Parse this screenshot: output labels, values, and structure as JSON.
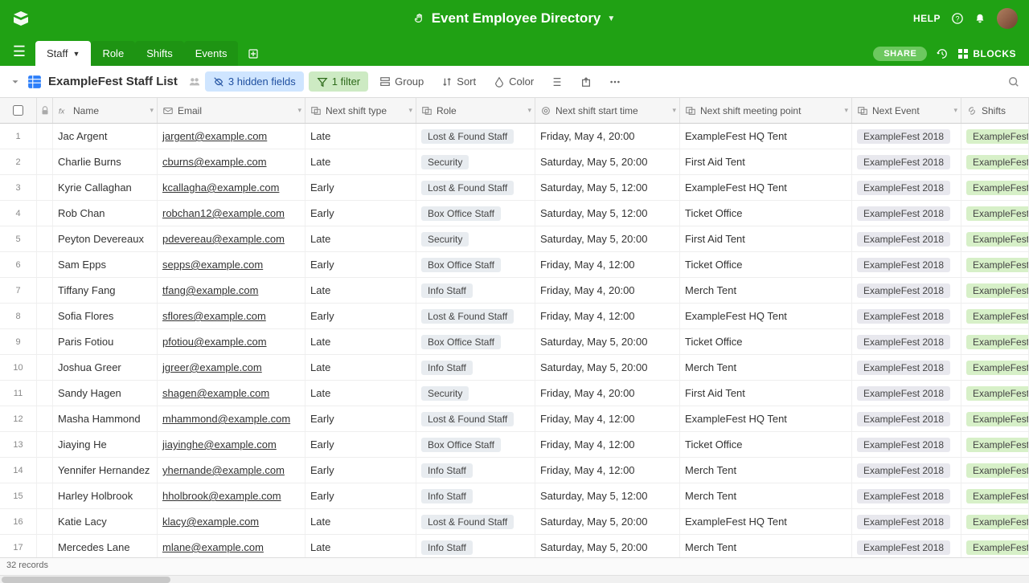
{
  "header": {
    "title": "Event Employee Directory",
    "help": "HELP",
    "share": "SHARE",
    "blocks": "BLOCKS"
  },
  "tabs": [
    {
      "label": "Staff",
      "active": true
    },
    {
      "label": "Role",
      "active": false
    },
    {
      "label": "Shifts",
      "active": false
    },
    {
      "label": "Events",
      "active": false
    }
  ],
  "toolbar": {
    "view_name": "ExampleFest Staff List",
    "hidden_fields": "3 hidden fields",
    "filter": "1 filter",
    "group": "Group",
    "sort": "Sort",
    "color": "Color"
  },
  "columns": {
    "name": "Name",
    "email": "Email",
    "next_shift_type": "Next shift type",
    "role": "Role",
    "next_shift_start_time": "Next shift start time",
    "next_shift_meeting_point": "Next shift meeting point",
    "next_event": "Next Event",
    "shifts": "Shifts"
  },
  "rows": [
    {
      "n": 1,
      "name": "Jac Argent",
      "email": "jargent@example.com",
      "shift": "Late",
      "role": "Lost & Found Staff",
      "start": "Friday, May 4, 20:00",
      "meeting": "ExampleFest HQ Tent",
      "event": "ExampleFest 2018",
      "shifts": "ExampleFest"
    },
    {
      "n": 2,
      "name": "Charlie Burns",
      "email": "cburns@example.com",
      "shift": "Late",
      "role": "Security",
      "start": "Saturday, May 5, 20:00",
      "meeting": "First Aid Tent",
      "event": "ExampleFest 2018",
      "shifts": "ExampleFest"
    },
    {
      "n": 3,
      "name": "Kyrie Callaghan",
      "email": "kcallagha@example.com",
      "shift": "Early",
      "role": "Lost & Found Staff",
      "start": "Saturday, May 5, 12:00",
      "meeting": "ExampleFest HQ Tent",
      "event": "ExampleFest 2018",
      "shifts": "ExampleFest"
    },
    {
      "n": 4,
      "name": "Rob Chan",
      "email": "robchan12@example.com",
      "shift": "Early",
      "role": "Box Office Staff",
      "start": "Saturday, May 5, 12:00",
      "meeting": "Ticket Office",
      "event": "ExampleFest 2018",
      "shifts": "ExampleFest"
    },
    {
      "n": 5,
      "name": "Peyton Devereaux",
      "email": "pdevereau@example.com",
      "shift": "Late",
      "role": "Security",
      "start": "Saturday, May 5, 20:00",
      "meeting": "First Aid Tent",
      "event": "ExampleFest 2018",
      "shifts": "ExampleFest"
    },
    {
      "n": 6,
      "name": "Sam Epps",
      "email": "sepps@example.com",
      "shift": "Early",
      "role": "Box Office Staff",
      "start": "Friday, May 4, 12:00",
      "meeting": "Ticket Office",
      "event": "ExampleFest 2018",
      "shifts": "ExampleFest"
    },
    {
      "n": 7,
      "name": "Tiffany Fang",
      "email": "tfang@example.com",
      "shift": "Late",
      "role": "Info Staff",
      "start": "Friday, May 4, 20:00",
      "meeting": "Merch Tent",
      "event": "ExampleFest 2018",
      "shifts": "ExampleFest"
    },
    {
      "n": 8,
      "name": "Sofia Flores",
      "email": "sflores@example.com",
      "shift": "Early",
      "role": "Lost & Found Staff",
      "start": "Friday, May 4, 12:00",
      "meeting": "ExampleFest HQ Tent",
      "event": "ExampleFest 2018",
      "shifts": "ExampleFest"
    },
    {
      "n": 9,
      "name": "Paris Fotiou",
      "email": "pfotiou@example.com",
      "shift": "Late",
      "role": "Box Office Staff",
      "start": "Saturday, May 5, 20:00",
      "meeting": "Ticket Office",
      "event": "ExampleFest 2018",
      "shifts": "ExampleFest"
    },
    {
      "n": 10,
      "name": "Joshua Greer",
      "email": "jgreer@example.com",
      "shift": "Late",
      "role": "Info Staff",
      "start": "Saturday, May 5, 20:00",
      "meeting": "Merch Tent",
      "event": "ExampleFest 2018",
      "shifts": "ExampleFest"
    },
    {
      "n": 11,
      "name": "Sandy Hagen",
      "email": "shagen@example.com",
      "shift": "Late",
      "role": "Security",
      "start": "Friday, May 4, 20:00",
      "meeting": "First Aid Tent",
      "event": "ExampleFest 2018",
      "shifts": "ExampleFest"
    },
    {
      "n": 12,
      "name": "Masha Hammond",
      "email": "mhammond@example.com",
      "shift": "Early",
      "role": "Lost & Found Staff",
      "start": "Friday, May 4, 12:00",
      "meeting": "ExampleFest HQ Tent",
      "event": "ExampleFest 2018",
      "shifts": "ExampleFest"
    },
    {
      "n": 13,
      "name": "Jiaying He",
      "email": "jiayinghe@example.com",
      "shift": "Early",
      "role": "Box Office Staff",
      "start": "Friday, May 4, 12:00",
      "meeting": "Ticket Office",
      "event": "ExampleFest 2018",
      "shifts": "ExampleFest"
    },
    {
      "n": 14,
      "name": "Yennifer Hernandez",
      "email": "yhernande@example.com",
      "shift": "Early",
      "role": "Info Staff",
      "start": "Friday, May 4, 12:00",
      "meeting": "Merch Tent",
      "event": "ExampleFest 2018",
      "shifts": "ExampleFest"
    },
    {
      "n": 15,
      "name": "Harley Holbrook",
      "email": "hholbrook@example.com",
      "shift": "Early",
      "role": "Info Staff",
      "start": "Saturday, May 5, 12:00",
      "meeting": "Merch Tent",
      "event": "ExampleFest 2018",
      "shifts": "ExampleFest"
    },
    {
      "n": 16,
      "name": "Katie Lacy",
      "email": "klacy@example.com",
      "shift": "Late",
      "role": "Lost & Found Staff",
      "start": "Saturday, May 5, 20:00",
      "meeting": "ExampleFest HQ Tent",
      "event": "ExampleFest 2018",
      "shifts": "ExampleFest"
    },
    {
      "n": 17,
      "name": "Mercedes Lane",
      "email": "mlane@example.com",
      "shift": "Late",
      "role": "Info Staff",
      "start": "Saturday, May 5, 20:00",
      "meeting": "Merch Tent",
      "event": "ExampleFest 2018",
      "shifts": "ExampleFest"
    }
  ],
  "footer": {
    "records": "32 records"
  }
}
